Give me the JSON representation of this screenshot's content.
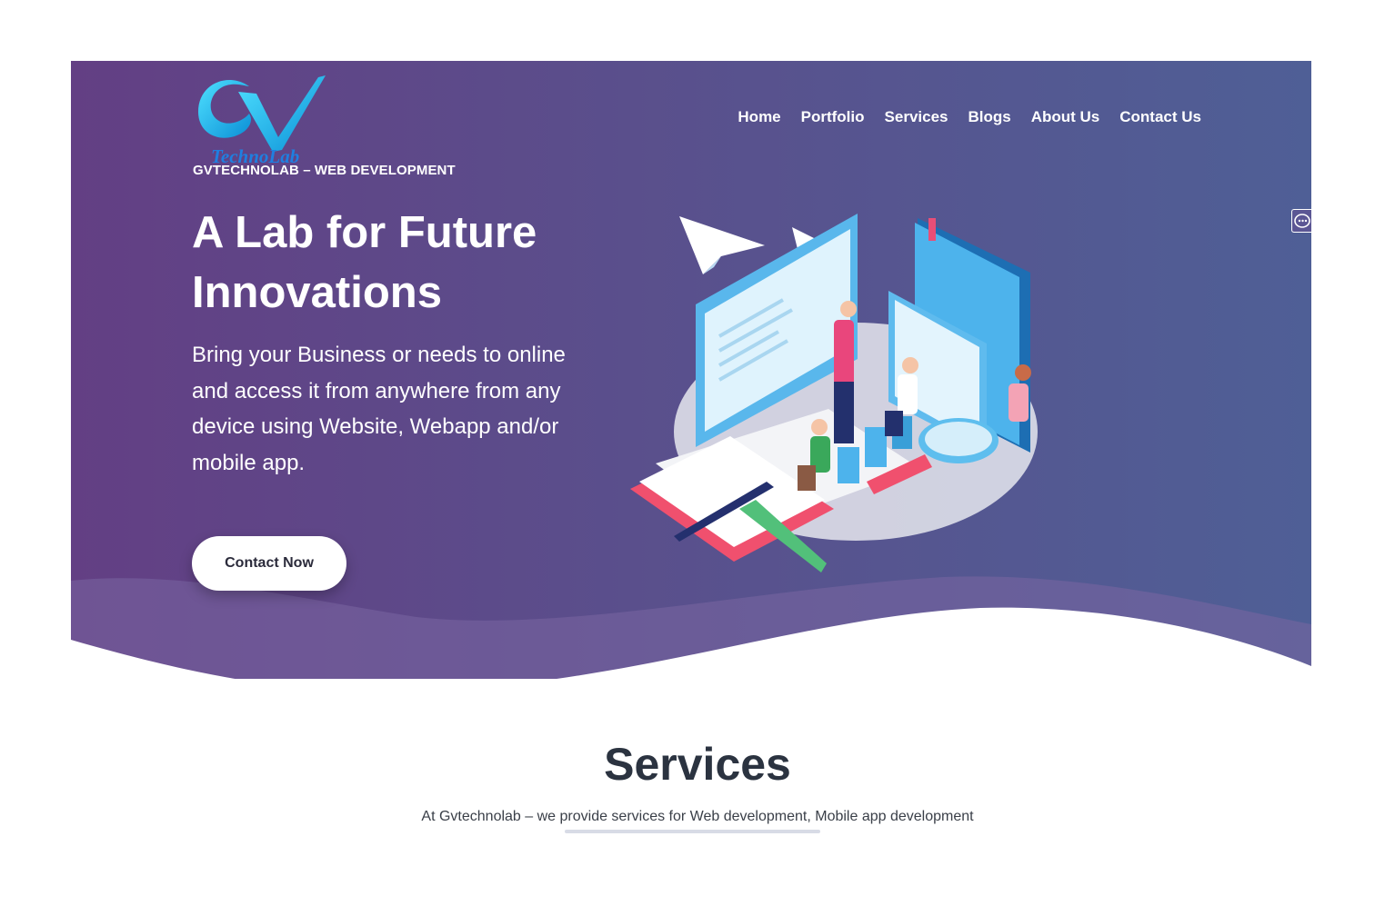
{
  "brand": {
    "logo_text": "TechnoLab",
    "tagline": "GVTECHNOLAB – WEB DEVELOPMENT"
  },
  "nav": {
    "items": [
      {
        "label": "Home"
      },
      {
        "label": "Portfolio"
      },
      {
        "label": "Services"
      },
      {
        "label": "Blogs"
      },
      {
        "label": "About Us"
      },
      {
        "label": "Contact Us"
      }
    ]
  },
  "hero": {
    "headline": "A Lab for Future Innovations",
    "subtext": "Bring your Business or needs to online and access it from anywhere from any device using Website, Webapp and/or mobile app.",
    "cta_label": "Contact Now"
  },
  "services": {
    "title": "Services",
    "subtitle": "At Gvtechnolab – we provide services for Web development, Mobile app development"
  },
  "icons": {
    "chat": "chat-bubble-icon"
  },
  "colors": {
    "hero_gradient_start": "#633f84",
    "hero_gradient_end": "#4f5f96",
    "logo_cyan": "#19c6f0",
    "heading_dark": "#2b3340"
  }
}
